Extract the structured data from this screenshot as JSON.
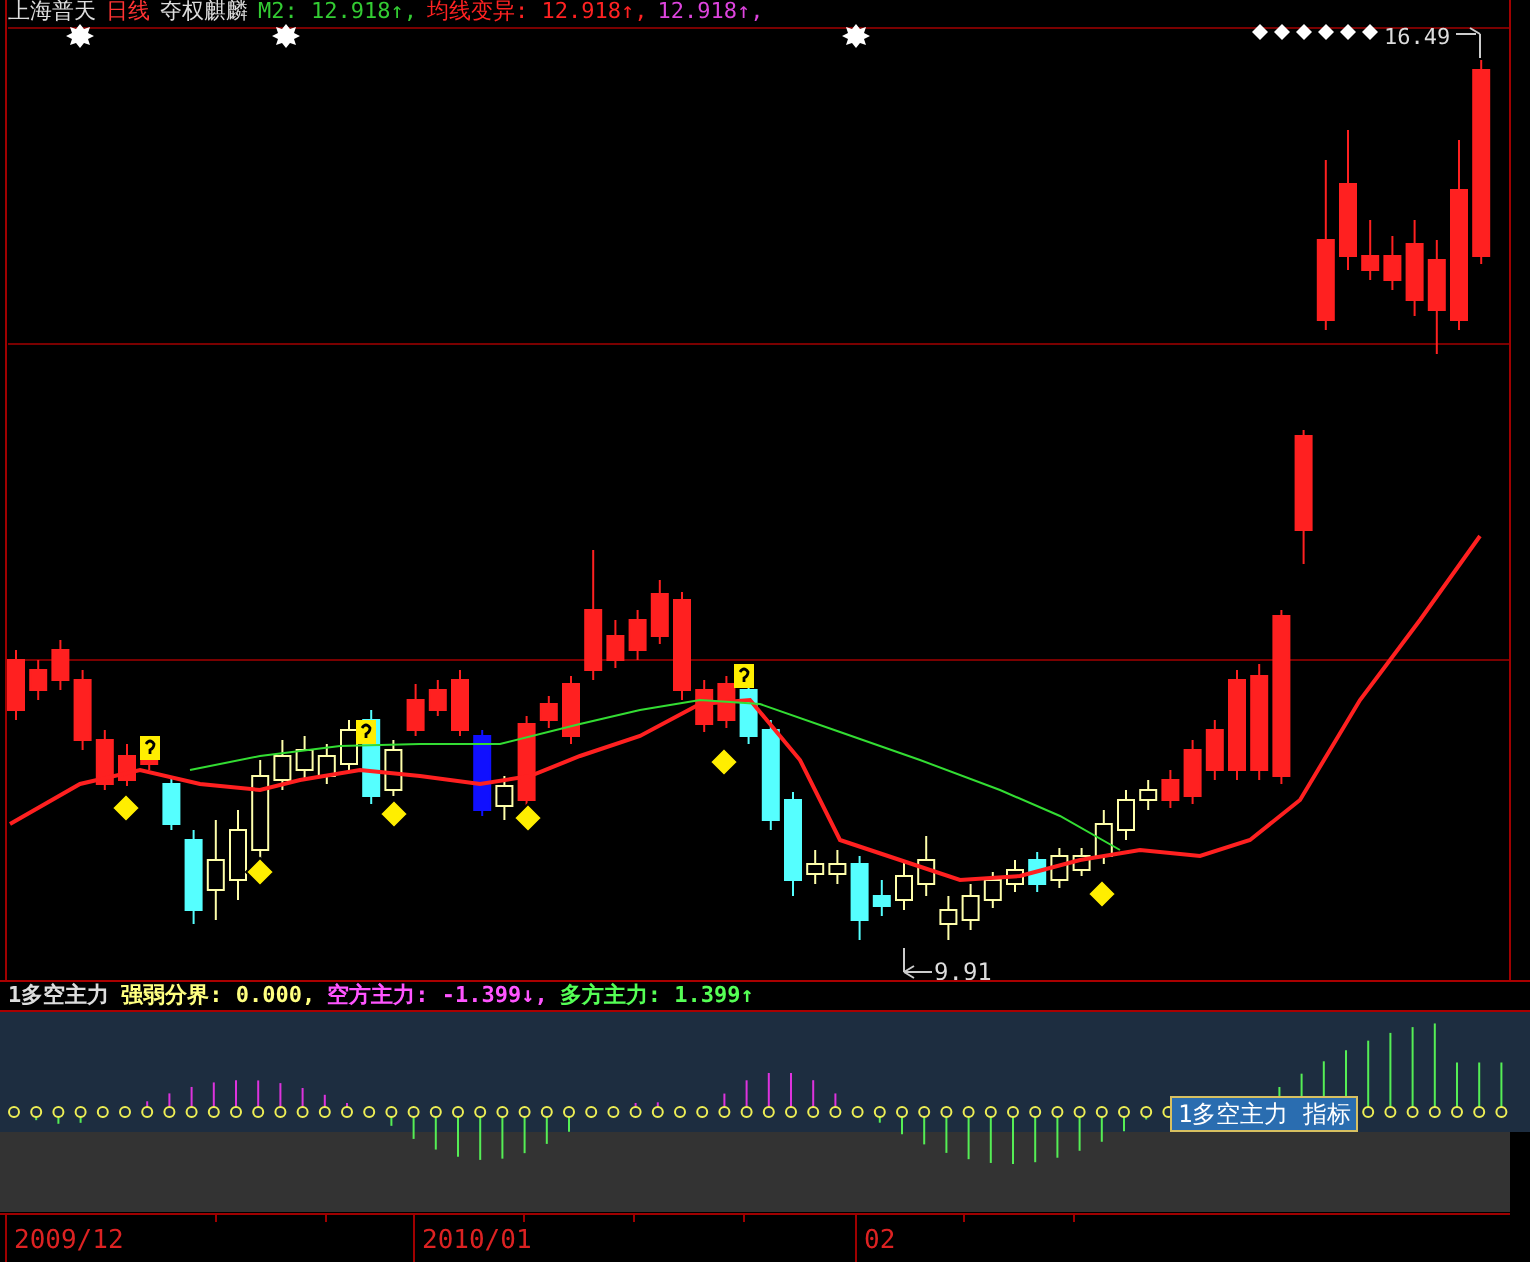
{
  "header": {
    "stock": "上海普天",
    "period": "日线",
    "mode": "夺权麒麟",
    "indicators": [
      {
        "text": "M2: 12.918↑,",
        "color": "#33cc33"
      },
      {
        "text": "均线变异: 12.918↑,",
        "color": "#ff2222"
      },
      {
        "text": "12.918↑,",
        "color": "#dd44dd"
      }
    ]
  },
  "price_labels": {
    "high": "16.49",
    "low": "9.91"
  },
  "indicator": {
    "name": "1多空主力",
    "items": [
      {
        "text": "强弱分界: 0.000,",
        "color": "#ffff80"
      },
      {
        "text": "空方主力: -1.399↓,",
        "color": "#ff55ff"
      },
      {
        "text": "多方主力: 1.399↑",
        "color": "#55ff55"
      }
    ],
    "tooltip": "1多空主力 指标"
  },
  "date_axis": [
    "2009/12",
    "2010/01",
    "02"
  ]
}
